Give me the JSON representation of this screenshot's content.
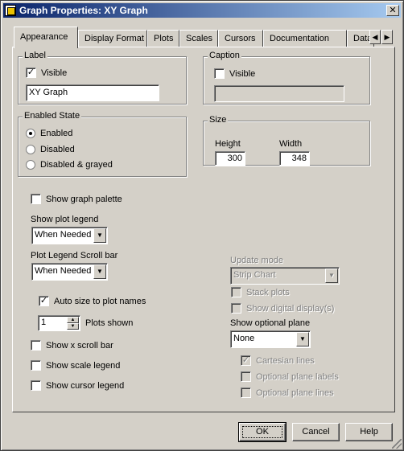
{
  "window": {
    "title": "Graph Properties: XY Graph"
  },
  "tabs": [
    {
      "label": "Appearance"
    },
    {
      "label": "Display Format"
    },
    {
      "label": "Plots"
    },
    {
      "label": "Scales"
    },
    {
      "label": "Cursors"
    },
    {
      "label": "Documentation"
    },
    {
      "label": "Data"
    }
  ],
  "label_group": {
    "title": "Label",
    "visible_label": "Visible",
    "visible_checked": true,
    "value": "XY Graph"
  },
  "caption_group": {
    "title": "Caption",
    "visible_label": "Visible",
    "visible_checked": false,
    "value": ""
  },
  "enabled_state": {
    "title": "Enabled State",
    "options": [
      "Enabled",
      "Disabled",
      "Disabled & grayed"
    ],
    "selected": "Enabled"
  },
  "size_group": {
    "title": "Size",
    "height_label": "Height",
    "height_value": "300",
    "width_label": "Width",
    "width_value": "348"
  },
  "options": {
    "show_graph_palette": "Show graph palette",
    "show_plot_legend_label": "Show plot legend",
    "show_plot_legend_value": "When Needed",
    "legend_scroll_label": "Plot Legend Scroll bar",
    "legend_scroll_value": "When Needed",
    "auto_size": "Auto size to plot names",
    "auto_size_checked": true,
    "plots_shown_value": "1",
    "plots_shown_label": "Plots shown",
    "show_x_scroll": "Show x scroll bar",
    "show_scale_legend": "Show scale legend",
    "show_cursor_legend": "Show cursor legend"
  },
  "right_options": {
    "update_mode_label": "Update mode",
    "update_mode_value": "Strip Chart",
    "stack_plots": "Stack plots",
    "show_digital_display": "Show digital display(s)",
    "optional_plane_label": "Show optional plane",
    "optional_plane_value": "None",
    "cartesian_lines": "Cartesian lines",
    "cartesian_checked": true,
    "plane_labels": "Optional plane labels",
    "plane_lines": "Optional plane lines"
  },
  "buttons": {
    "ok": "OK",
    "cancel": "Cancel",
    "help": "Help"
  },
  "icons": {
    "app": "labview-app-icon",
    "close": "close-icon",
    "tab_left": "arrow-left-icon",
    "tab_right": "arrow-right-icon",
    "dropdown": "chevron-down-icon"
  }
}
